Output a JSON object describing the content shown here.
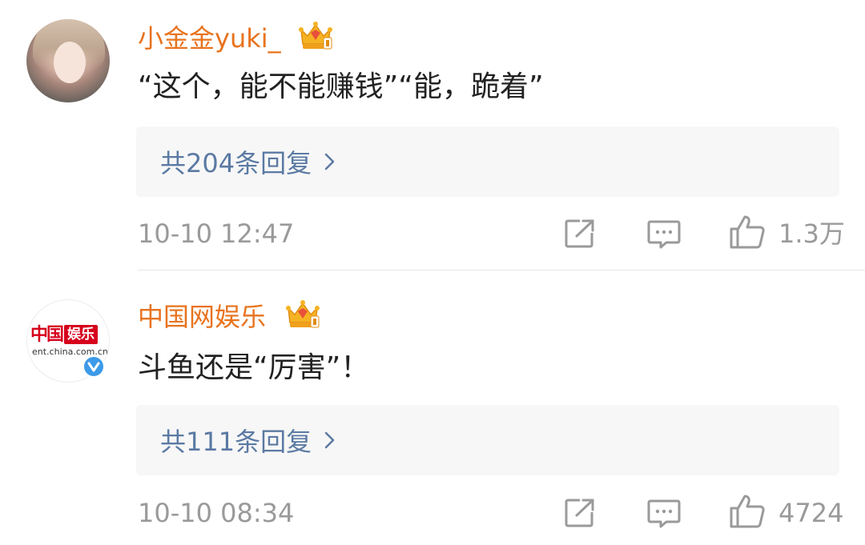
{
  "comments": [
    {
      "username": "小金金yuki_",
      "text": "“这个，能不能赚钱”“能，跪着”",
      "replies": "共204条回复",
      "timestamp": "10-10 12:47",
      "likes": "1.3万",
      "avatar_icon": "user-photo-avatar",
      "badge_icon": "crown-badge-icon"
    },
    {
      "username": "中国网娱乐",
      "text": "斗鱼还是“厉害”！",
      "replies": "共111条回复",
      "timestamp": "10-10 08:34",
      "likes": "4724",
      "avatar_logo": {
        "cn": "中国",
        "box": "娱乐",
        "url": "ent.china.com.cn"
      },
      "verified": true,
      "badge_icon": "crown-badge-icon"
    }
  ],
  "colors": {
    "username": "#e8731e",
    "reply_link": "#5b7aa3",
    "meta": "#9a9a9a",
    "verified": "#3d9ae8",
    "logo_red": "#d6001c"
  }
}
